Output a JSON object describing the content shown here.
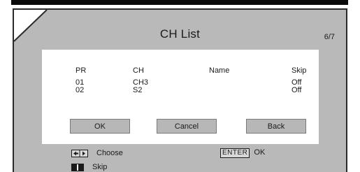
{
  "window": {
    "title": "CH List",
    "page": "6/7"
  },
  "table": {
    "headers": {
      "pr": "PR",
      "ch": "CH",
      "name": "Name",
      "skip": "Skip"
    },
    "rows": [
      {
        "pr": "01",
        "ch": "CH3",
        "name": "",
        "skip": "Off"
      },
      {
        "pr": "02",
        "ch": "S2",
        "name": "",
        "skip": "Off"
      }
    ]
  },
  "buttons": {
    "ok": "OK",
    "cancel": "Cancel",
    "back": "Back"
  },
  "legend": {
    "choose_label": "Choose",
    "enter_key": "ENTER",
    "enter_label": "OK",
    "skip_label": "Skip"
  },
  "icons": {
    "corner": "corner-fold-icon",
    "arrows": "left-right-arrow-keys-icon",
    "skip": "skip-key-icon"
  },
  "colors": {
    "panel": "#b9b9b9",
    "list_background": "#ffffff",
    "button": "#b7b7b7",
    "top_bar": "#0a0a0a"
  }
}
